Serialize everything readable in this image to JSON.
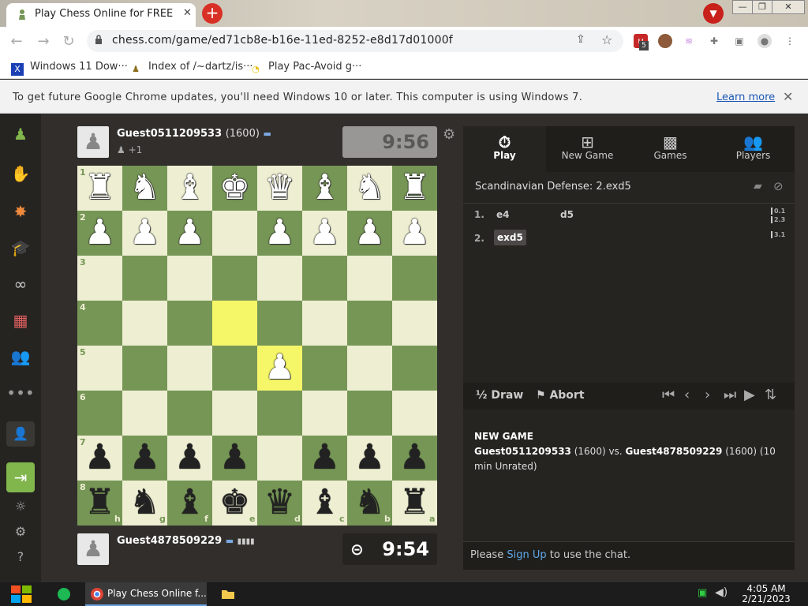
{
  "browser": {
    "tab_title": "Play Chess Online for FREE",
    "url": "chess.com/game/ed71cb8e-b16e-11ed-8252-e8d17d01000f",
    "ext_badge": "5",
    "bookmarks": [
      {
        "label": "Windows 11 Dow···",
        "icon": "X"
      },
      {
        "label": "Index of /~dartz/is···",
        "icon": "♟"
      },
      {
        "label": "Play Pac-Avoid g···",
        "icon": "◔"
      }
    ],
    "infobar_message": "To get future Google Chrome updates, you'll need Windows 10 or later. This computer is using Windows 7.",
    "infobar_link": "Learn more"
  },
  "game": {
    "top_player": {
      "name": "Guest0511209533",
      "rating": "(1600)",
      "captured": "+1",
      "clock": "9:56"
    },
    "bottom_player": {
      "name": "Guest4878509229",
      "clock": "9:54"
    },
    "ranks_left": [
      "1",
      "2",
      "3",
      "4",
      "5",
      "6",
      "7",
      "8"
    ],
    "files_bottom": [
      "h",
      "g",
      "f",
      "e",
      "d",
      "c",
      "b",
      "a"
    ],
    "board": [
      [
        "R",
        "N",
        "B",
        "K",
        "Q",
        "B",
        "N",
        "R"
      ],
      [
        "P",
        "P",
        "P",
        "",
        "P",
        "P",
        "P",
        "P"
      ],
      [
        "",
        "",
        "",
        "",
        "",
        "",
        "",
        ""
      ],
      [
        "",
        "",
        "",
        "",
        "",
        "",
        "",
        ""
      ],
      [
        "",
        "",
        "",
        "",
        "P",
        "",
        "",
        ""
      ],
      [
        "",
        "",
        "",
        "",
        "",
        "",
        "",
        ""
      ],
      [
        "p",
        "p",
        "p",
        "p",
        "",
        "p",
        "p",
        "p"
      ],
      [
        "r",
        "n",
        "b",
        "k",
        "q",
        "b",
        "n",
        "r"
      ]
    ],
    "highlight_squares": [
      [
        3,
        3
      ],
      [
        4,
        4
      ]
    ]
  },
  "panel": {
    "tabs": [
      {
        "label": "Play",
        "icon": "stopwatch-icon"
      },
      {
        "label": "New Game",
        "icon": "plus-icon"
      },
      {
        "label": "Games",
        "icon": "board-icon"
      },
      {
        "label": "Players",
        "icon": "players-icon"
      }
    ],
    "opening": "Scandinavian Defense: 2.exd5",
    "moves": [
      {
        "no": "1.",
        "white": "e4",
        "black": "d5",
        "t1": "0.1",
        "t2": "2.3"
      },
      {
        "no": "2.",
        "white": "exd5",
        "black": "",
        "t1": "3.1",
        "t2": ""
      }
    ],
    "draw_label": "Draw",
    "draw_icon": "½",
    "abort_label": "Abort",
    "gameinfo_title": "NEW GAME",
    "gameinfo_p1": "Guest0511209533",
    "gameinfo_r1": "(1600) vs.",
    "gameinfo_p2": "Guest4878509229",
    "gameinfo_r2": "(1600) (10 min Unrated)",
    "chat_pre": "Please",
    "chat_link": "Sign Up",
    "chat_post": "to use the chat."
  },
  "taskbar": {
    "chrome_label": "Play Chess Online f...",
    "time": "4:05 AM",
    "date": "2/21/2023"
  }
}
